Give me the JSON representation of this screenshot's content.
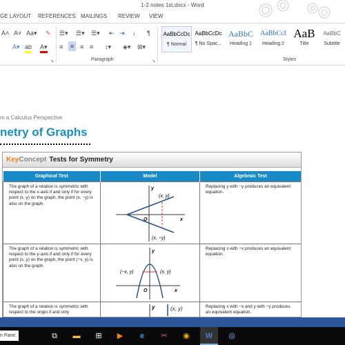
{
  "window": {
    "title": "1-2 notes 1st.docx - Word"
  },
  "tabs": [
    "GE LAYOUT",
    "REFERENCES",
    "MAILINGS",
    "REVIEW",
    "VIEW"
  ],
  "ribbon": {
    "groups": {
      "paragraph": "Paragraph",
      "styles": "Styles"
    },
    "styles": [
      {
        "preview": "AaBbCcDc",
        "name": "¶ Normal"
      },
      {
        "preview": "AaBbCcDc",
        "name": "¶ No Spac..."
      },
      {
        "preview": "AaBbC",
        "name": "Heading 1"
      },
      {
        "preview": "AaBbCcI",
        "name": "Heading 2"
      },
      {
        "preview": "AaB",
        "name": "Title"
      },
      {
        "preview": "AaBbC",
        "name": "Subtitle"
      }
    ]
  },
  "document": {
    "subtitle": "m a Calculus Perspective",
    "heading": "netry of Graphs",
    "keyconcept": {
      "key": "Key",
      "concept": "Concept",
      "title": "Tests for Symmetry"
    },
    "columns": [
      "Graphical Test",
      "Model",
      "Algebraic Test"
    ],
    "rows": [
      {
        "graphical": "The graph of a relation is symmetric with respect to the x-axis if and only if for every point (x, y) on the graph, the point (x, −y) is also on the graph.",
        "algebraic": "Replacing y with −y produces an equivalent equation.",
        "labels": [
          "(x, y)",
          "(x, −y)",
          "O",
          "x",
          "y"
        ]
      },
      {
        "graphical": "The graph of a relation is symmetric with respect to the y-axis if and only if for every point (x, y) on the graph, the point (−x, y) is also on the graph.",
        "algebraic": "Replacing x with −x produces an equivalent equation.",
        "labels": [
          "(−x, y)",
          "(x, y)",
          "O",
          "x",
          "y"
        ]
      },
      {
        "graphical": "The graph of a relation is symmetric with respect to the origin if and only",
        "algebraic": "Replacing x with −x and y with −y produces an equivalent equation.",
        "labels": [
          "(x, y)",
          "y"
        ]
      }
    ]
  },
  "taskbar": {
    "search_text": "n Pane.",
    "apps": [
      "task-view",
      "file-explorer",
      "store",
      "media",
      "edge",
      "snipping",
      "chrome",
      "word",
      "cortana"
    ]
  },
  "colors": {
    "accent": "#1a8ac6",
    "heading": "#1b8ec2",
    "key": "#f07f19",
    "status": "#2b579a"
  }
}
